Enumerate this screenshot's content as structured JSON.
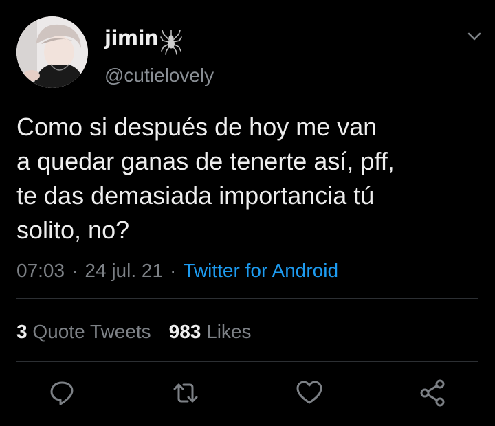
{
  "user": {
    "display_name": "jimin",
    "handle": "@cutielovely",
    "badge_icon": "spider-icon"
  },
  "tweet": {
    "text": "Como si después de hoy me van\na quedar ganas de tenerte así, pff,\nte das demasiada importancia tú\nsolito, no?",
    "time": "07:03",
    "date": "24 jul. 21",
    "source": "Twitter for Android"
  },
  "stats": {
    "quote_count": "3",
    "quote_label": "Quote Tweets",
    "like_count": "983",
    "like_label": "Likes"
  },
  "actions": [
    "reply-icon",
    "retweet-icon",
    "like-icon",
    "share-icon"
  ],
  "colors": {
    "background": "#000000",
    "text": "#eeeeee",
    "secondary": "#7d8186",
    "link": "#1d9bf0",
    "divider": "#2c2f33"
  }
}
